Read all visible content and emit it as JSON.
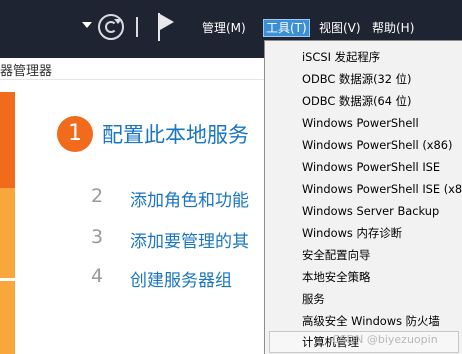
{
  "menubar": {
    "items": [
      {
        "label": "管理(M)"
      },
      {
        "label": "工具(T)"
      },
      {
        "label": "视图(V)"
      },
      {
        "label": "帮助(H)"
      }
    ]
  },
  "header": {
    "title": "器管理器"
  },
  "welcome": {
    "step1": {
      "number": "1",
      "label": "配置此本地服务"
    },
    "step2": {
      "number": "2",
      "label": "添加角色和功能"
    },
    "step3": {
      "number": "3",
      "label": "添加要管理的其"
    },
    "step4": {
      "number": "4",
      "label": "创建服务器组"
    }
  },
  "tools_menu": {
    "items": [
      "iSCSI 发起程序",
      "ODBC 数据源(32 位)",
      "ODBC 数据源(64 位)",
      "Windows PowerShell",
      "Windows PowerShell (x86)",
      "Windows PowerShell ISE",
      "Windows PowerShell ISE (x8",
      "Windows Server Backup",
      "Windows 内存诊断",
      "安全配置向导",
      "本地安全策略",
      "服务",
      "高级安全 Windows 防火墙",
      "计算机管理"
    ]
  },
  "watermark": "CSDN @biyezuopin",
  "colors": {
    "toolbar_bg": "#1e2431",
    "accent_orange": "#f26a1b",
    "light_orange": "#f8a73d",
    "link_blue": "#1a76c2",
    "menu_active": "#3c8fd6"
  }
}
